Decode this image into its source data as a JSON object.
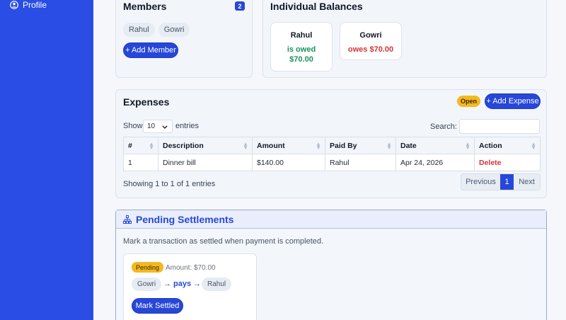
{
  "sidebar": {
    "profile_label": "Profile"
  },
  "members": {
    "title": "Members",
    "count": "2",
    "items": [
      "Rahul",
      "Gowri"
    ],
    "add_button": "+ Add Member"
  },
  "balances": {
    "title": "Individual Balances",
    "items": [
      {
        "name": "Rahul",
        "line1": "is owed",
        "line2": "$70.00"
      },
      {
        "name": "Gowri",
        "line1": "owes $70.00"
      }
    ]
  },
  "expenses": {
    "title": "Expenses",
    "status": "Open",
    "add_button": "+ Add Expense",
    "show_label": "Show",
    "entries_value": "10",
    "entries_label": "entries",
    "search_label": "Search:",
    "columns": [
      "#",
      "Description",
      "Amount",
      "Paid By",
      "Date",
      "Action"
    ],
    "rows": [
      {
        "num": "1",
        "description": "Dinner bill",
        "amount": "$140.00",
        "paid_by": "Rahul",
        "date": "Apr 24, 2026",
        "action": "Delete"
      }
    ],
    "info": "Showing 1 to 1 of 1 entries",
    "pager": {
      "previous": "Previous",
      "page": "1",
      "next": "Next"
    }
  },
  "settlements": {
    "title": "Pending Settlements",
    "description": "Mark a transaction as settled when payment is completed.",
    "item": {
      "status": "Pending",
      "amount": "Amount: $70.00",
      "from": "Gowri",
      "arrow_text": "→ pays →",
      "to": "Rahul",
      "button": "Mark Settled"
    }
  },
  "colors": {
    "sidebar": "#2a4de6",
    "primary": "#2747d9",
    "warning": "#f4b820",
    "success": "#16945e",
    "danger": "#dc2f3a"
  }
}
